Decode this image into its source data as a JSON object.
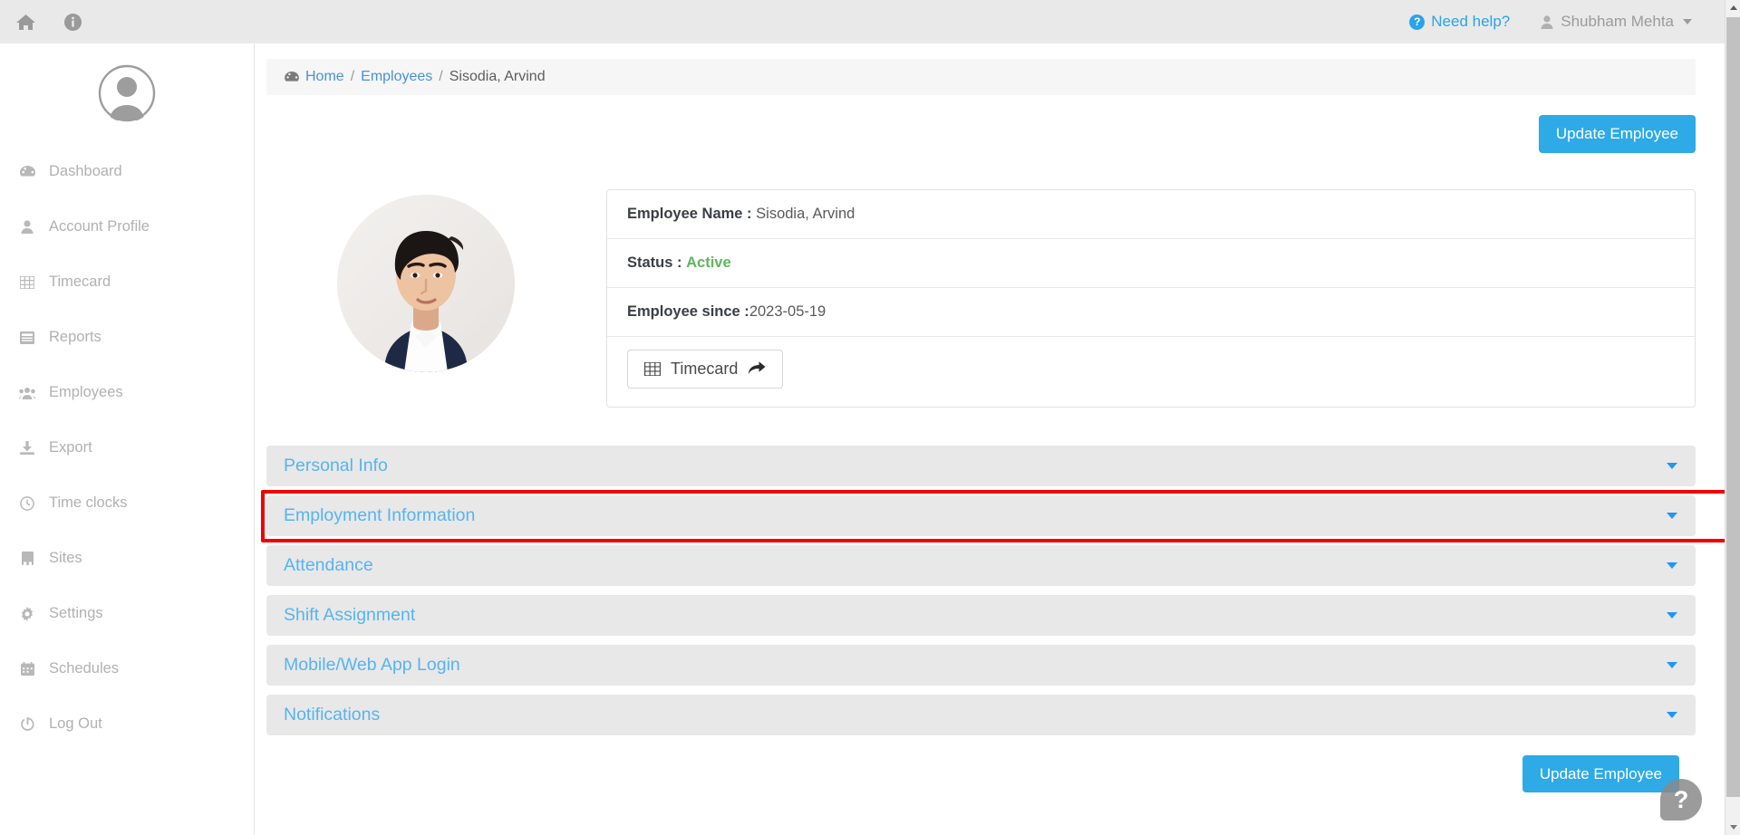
{
  "topbar": {
    "home_icon": "home-icon",
    "info_icon": "info-icon",
    "need_help_label": "Need help?",
    "need_help_icon": "question-circle-icon",
    "user_name": "Shubham Mehta",
    "user_icon": "user-icon",
    "caret_icon": "caret-down-icon"
  },
  "sidebar": {
    "avatar_icon": "default-user-avatar",
    "items": [
      {
        "label": "Dashboard",
        "icon": "dashboard-icon"
      },
      {
        "label": "Account Profile",
        "icon": "user-icon"
      },
      {
        "label": "Timecard",
        "icon": "table-grid-icon"
      },
      {
        "label": "Reports",
        "icon": "report-list-icon"
      },
      {
        "label": "Employees",
        "icon": "users-group-icon"
      },
      {
        "label": "Export",
        "icon": "download-icon"
      },
      {
        "label": "Time clocks",
        "icon": "clock-icon"
      },
      {
        "label": "Sites",
        "icon": "building-icon"
      },
      {
        "label": "Settings",
        "icon": "gear-icon"
      },
      {
        "label": "Schedules",
        "icon": "calendar-icon"
      },
      {
        "label": "Log Out",
        "icon": "power-off-icon"
      }
    ]
  },
  "breadcrumb": {
    "icon": "dashboard-icon",
    "home": "Home",
    "sep1": "/",
    "employees": "Employees",
    "sep2": "/",
    "current": "Sisodia, Arvind"
  },
  "actions": {
    "update_employee_top": "Update Employee",
    "update_employee_bottom": "Update Employee"
  },
  "employee": {
    "photo_alt": "employee-photo",
    "name_label": "Employee Name :",
    "name_value": "Sisodia, Arvind",
    "status_label": "Status :",
    "status_value": "Active",
    "status_color": "#5cb85c",
    "since_label": "Employee since :",
    "since_value": "2023-05-19",
    "timecard_button": "Timecard",
    "timecard_icon": "table-grid-icon",
    "timecard_arrow_icon": "share-arrow-icon"
  },
  "accordion": {
    "caret_icon": "caret-down-icon",
    "highlight_color": "#f20000",
    "panels": [
      {
        "label": "Personal Info",
        "highlighted": false
      },
      {
        "label": "Employment Information",
        "highlighted": true
      },
      {
        "label": "Attendance",
        "highlighted": false
      },
      {
        "label": "Shift Assignment",
        "highlighted": false
      },
      {
        "label": "Mobile/Web App Login",
        "highlighted": false
      },
      {
        "label": "Notifications",
        "highlighted": false
      }
    ]
  },
  "help_bubble": {
    "glyph": "?",
    "name": "help-chat-bubble"
  },
  "colors": {
    "accent": "#2eaae6",
    "link": "#56b4ef",
    "topbar_bg": "#e9e9e9"
  }
}
